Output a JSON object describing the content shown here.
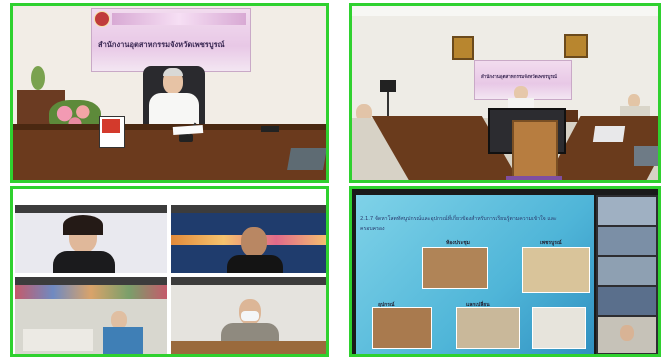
{
  "top_left": {
    "banner_text": "สำนักงานอุตสาหกรรมจังหวัดเพชรบูรณ์",
    "badge_text": "ผู้ว่าฯ"
  },
  "top_right": {
    "banner_text": "สำนักงานอุตสาหกรรมจังหวัดเพชรบูรณ์"
  },
  "bottom_right": {
    "slide_heading": "2.1.7 จัดหาโสตทัศนูปกรณ์และอุปกรณ์ที่เกี่ยวข้องสำหรับการเรียนรู้ตามความเข้าใจ และ",
    "slide_heading_2": "ครอบครอง",
    "labels": [
      "ห้องประชุม",
      "เพชรบูรณ์",
      "อุปกรณ์",
      "แลกเปลี่ยน"
    ]
  },
  "colors": {
    "frame": "#2fd12f",
    "banner": "#e8c8e6"
  }
}
